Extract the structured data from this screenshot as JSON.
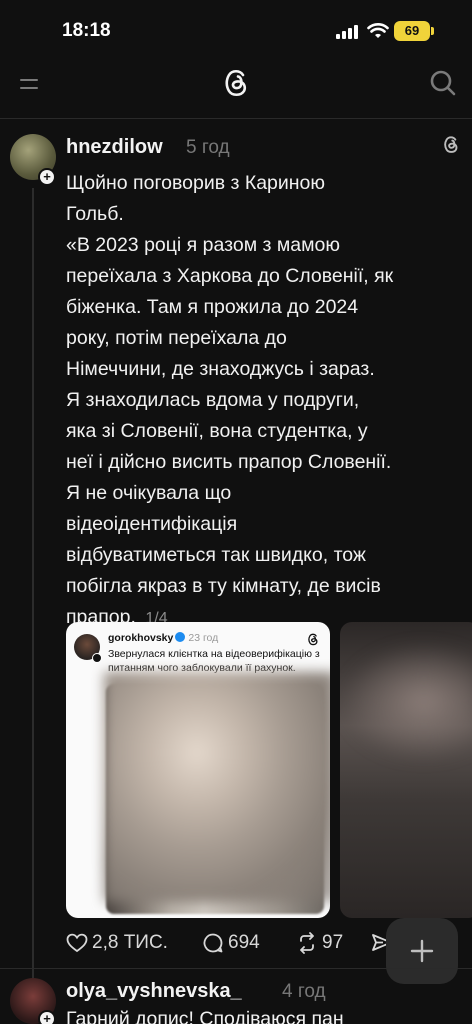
{
  "status_bar": {
    "time": "18:18",
    "battery": "69"
  },
  "post": {
    "username": "hnezdilow",
    "time": "5 год",
    "text_lines": [
      "Щойно поговорив з Кариною",
      "Гольб.",
      "«В 2023 році я разом з мамою",
      "переїхала з Харкова до Словенії, як",
      "біженка. Там я прожила до 2024",
      "року, потім переїхала до",
      "Німеччини, де знаходжусь і зараз.",
      "Я знаходилась вдома у подруги,",
      "яка зі Словенії, вона студентка, у",
      "неї і дійсно висить прапор Словенії.",
      "Я не очікувала що",
      "відеоідентифікація",
      "відбуватиметься так швидко, тож",
      "побігла якраз в ту кімнату, де висів"
    ],
    "last_line": "прапор.",
    "page_counter": "1/4",
    "embedded": {
      "username": "gorokhovsky",
      "time": "23 год",
      "text": "Звернулася клієнтка на відеоверифікацію з питанням чого заблокували її рахунок."
    },
    "likes": "2,8 ТИС.",
    "comments": "694",
    "reposts": "97"
  },
  "reply": {
    "username": "olya_vyshnevska_",
    "time": "4 год",
    "text": "Гарний допис! Сподіваюся пан"
  },
  "icons": {
    "menu": "menu-icon",
    "logo": "threads-logo-icon",
    "search": "search-icon",
    "like": "heart-icon",
    "comment": "comment-icon",
    "repost": "repost-icon",
    "share": "share-icon",
    "fab": "plus-icon"
  }
}
